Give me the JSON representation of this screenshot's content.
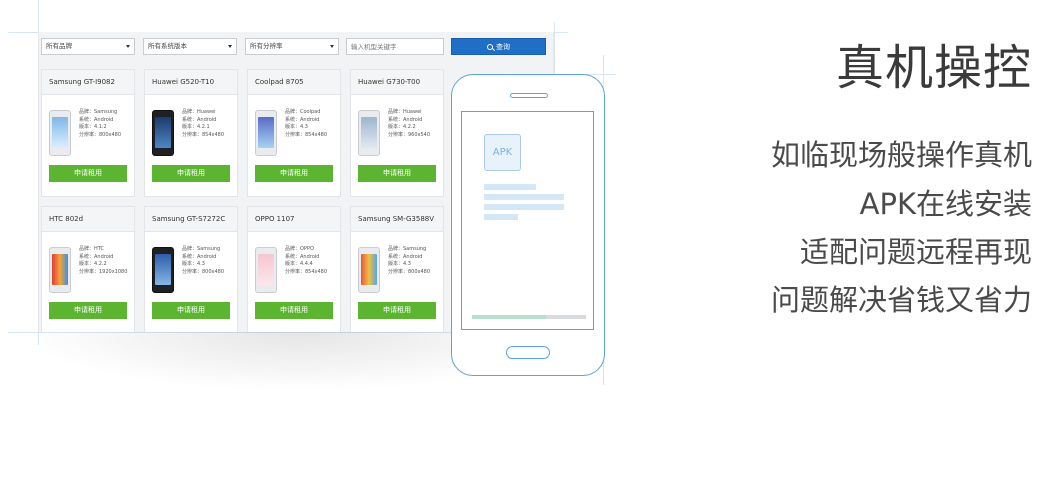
{
  "filters": {
    "brand": "所有品牌",
    "os_version": "所有系统版本",
    "resolution": "所有分辨率",
    "search_placeholder": "输入机型关键字",
    "search_button": "查询"
  },
  "device_cards": [
    {
      "name": "Samsung GT-I9082",
      "brand": "品牌：Samsung",
      "system": "系统：Android",
      "version": "版本：4.1.2",
      "resolution": "分辨率：800x480",
      "button": "申请租用"
    },
    {
      "name": "Huawei G520-T10",
      "brand": "品牌：Huawei",
      "system": "系统：Android",
      "version": "版本：4.2.1",
      "resolution": "分辨率：854x480",
      "button": "申请租用"
    },
    {
      "name": "Coolpad 8705",
      "brand": "品牌：Coolpad",
      "system": "系统：Android",
      "version": "版本：4.3",
      "resolution": "分辨率：854x480",
      "button": "申请租用"
    },
    {
      "name": "Huawei G730-T00",
      "brand": "品牌：Huawei",
      "system": "系统：Android",
      "version": "版本：4.2.2",
      "resolution": "分辨率：960x540",
      "button": "申请租用"
    },
    {
      "name": "HTC 802d",
      "brand": "品牌：HTC",
      "system": "系统：Android",
      "version": "版本：4.2.2",
      "resolution": "分辨率：1920x1080",
      "button": "申请租用"
    },
    {
      "name": "Samsung GT-S7272C",
      "brand": "品牌：Samsung",
      "system": "系统：Android",
      "version": "版本：4.3",
      "resolution": "分辨率：800x480",
      "button": "申请租用"
    },
    {
      "name": "OPPO 1107",
      "brand": "品牌：OPPO",
      "system": "系统：Android",
      "version": "版本：4.4.4",
      "resolution": "分辨率：854x480",
      "button": "申请租用"
    },
    {
      "name": "Samsung SM-G3588V",
      "brand": "品牌：Samsung",
      "system": "系统：Android",
      "version": "版本：4.3",
      "resolution": "分辨率：800x480",
      "button": "申请租用"
    }
  ],
  "phone_illustration": {
    "apk_label": "APK",
    "progress_fraction": 0.65
  },
  "headline": "真机操控",
  "features": [
    "如临现场般操作真机",
    "APK在线安装",
    "适配问题远程再现",
    "问题解决省钱又省力"
  ],
  "colors": {
    "primary_blue": "#1f6fc6",
    "apply_green": "#5cb531",
    "outline_blue": "#5aa3dc"
  }
}
